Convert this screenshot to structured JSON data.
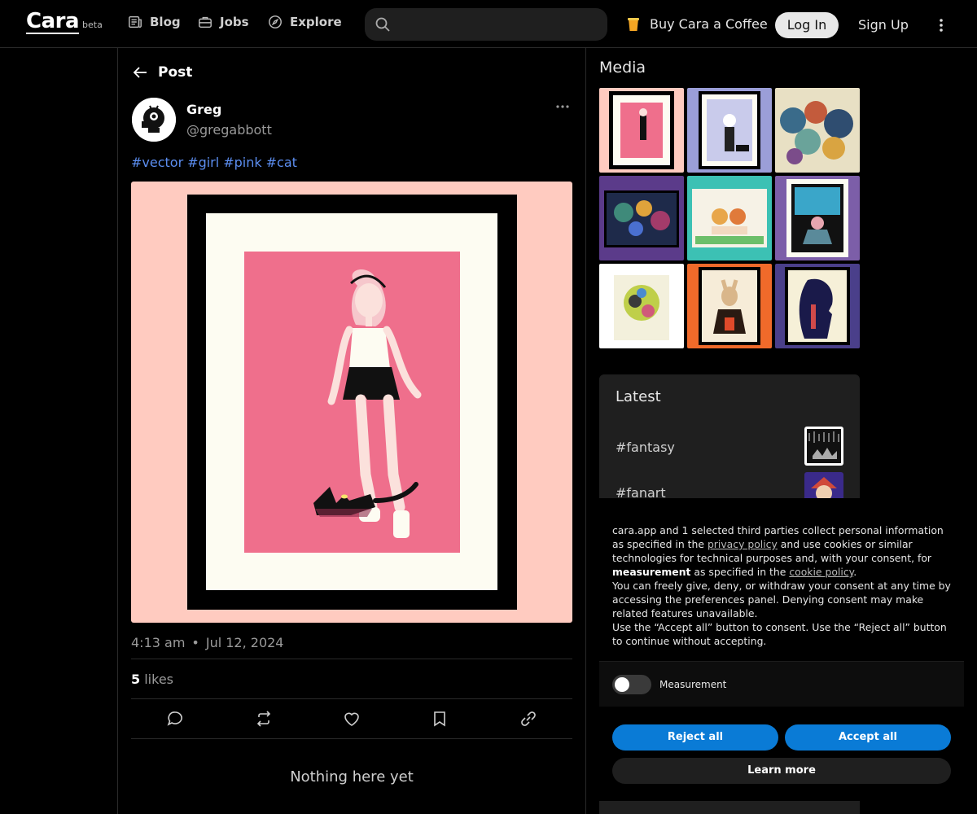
{
  "topbar": {
    "logo": "Cara",
    "logo_badge": "beta",
    "nav": [
      {
        "label": "Blog",
        "icon": "newspaper-icon"
      },
      {
        "label": "Jobs",
        "icon": "briefcase-icon"
      },
      {
        "label": "Explore",
        "icon": "compass-icon"
      }
    ],
    "search_placeholder": "",
    "coffee_label": "Buy Cara a Coffee",
    "login_label": "Log In",
    "signup_label": "Sign Up"
  },
  "post": {
    "header_title": "Post",
    "author_name": "Greg",
    "author_handle": "@gregabbott",
    "tags": [
      "#vector",
      "#girl",
      "#pink",
      "#cat"
    ],
    "time": "4:13 am",
    "date": "Jul 12, 2024",
    "likes_count": "5",
    "likes_label": "likes",
    "empty_comments": "Nothing here yet"
  },
  "sidebar": {
    "media_title": "Media",
    "latest_title": "Latest",
    "latest_tags": [
      "#fantasy",
      "#fanart"
    ]
  },
  "consent": {
    "text_1": "cara.app and 1 selected third parties collect personal information as specified in the ",
    "privacy_link": "privacy policy",
    "text_2": " and use cookies or similar technologies for technical purposes and, with your consent, for ",
    "measurement_bold": "measurement",
    "text_3": " as specified in the ",
    "cookie_link": "cookie policy",
    "text_4": ".",
    "paragraph_2": "You can freely give, deny, or withdraw your consent at any time by accessing the preferences panel. Denying consent may make related features unavailable.",
    "paragraph_3": "Use the “Accept all” button to consent. Use the “Reject all” button to continue without accepting.",
    "toggle_label": "Measurement",
    "reject_label": "Reject all",
    "accept_label": "Accept all",
    "learn_label": "Learn more"
  },
  "colors": {
    "accent_blue": "#0a7bd6",
    "tag_blue": "#5b8def",
    "post_bg_pink": "#ffcbc0",
    "art_pink": "#ef6f8c"
  }
}
